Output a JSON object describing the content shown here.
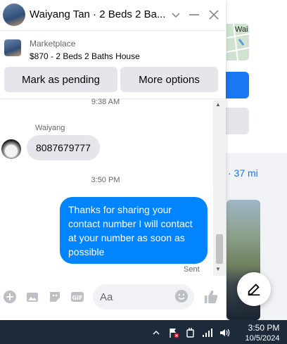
{
  "chat": {
    "title": "Waiyang Tan · 2 Beds 2 Ba...",
    "marketplace_label": "Marketplace",
    "listing_summary": "$870 - 2 Beds 2 Baths House",
    "mark_pending_label": "Mark as pending",
    "more_options_label": "More options",
    "messages": {
      "timestamp_top": "9:38 AM",
      "sender_name": "Waiyang",
      "incoming_text": "8087679777",
      "timestamp_mid": "3:50 PM",
      "outgoing_text": "Thanks for sharing your contact number I will contact at your number as soon as possible",
      "status": "Sent"
    },
    "composer": {
      "placeholder": "Aa"
    }
  },
  "background": {
    "map_label": "Wai",
    "distance": "· 37 mi"
  },
  "taskbar": {
    "time": "3:50 PM",
    "date": "10/5/2024"
  },
  "colors": {
    "accent": "#0084ff",
    "bubble_in": "#e4e6eb",
    "taskbar": "#1c2a3a"
  }
}
